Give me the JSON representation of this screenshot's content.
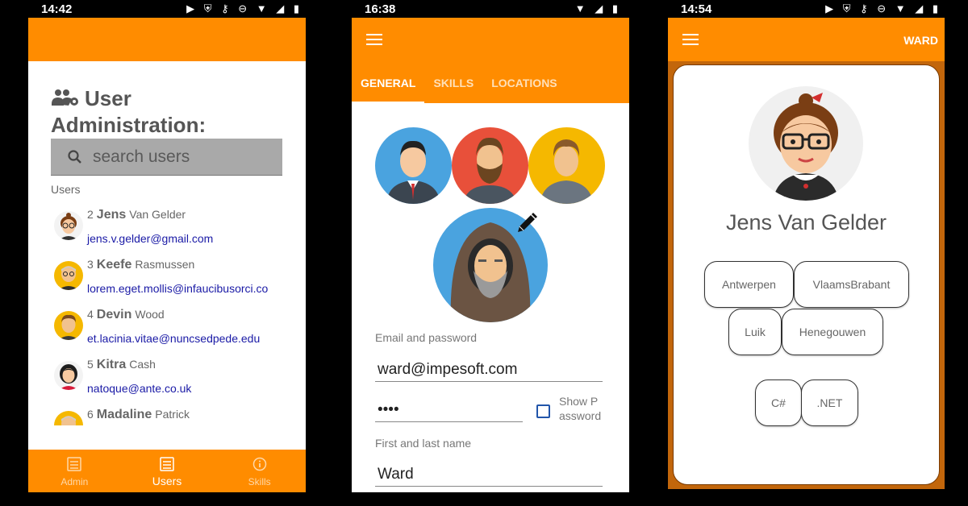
{
  "colors": {
    "accent": "#ff8c00",
    "email": "#1a1aa6",
    "frame": "#c2660b"
  },
  "phone1": {
    "status": {
      "time": "14:42",
      "icons": "▶ ⛨  ⚷ ⊖ ▼ ◢ ▮"
    },
    "title_line1": "User",
    "title_line2": "Administration:",
    "search": {
      "placeholder": "search users"
    },
    "users_label": "Users",
    "users": [
      {
        "id": "2",
        "first": "Jens",
        "last": "Van Gelder",
        "email": "jens.v.gelder@gmail.com",
        "avatar": "woman-glasses-avatar"
      },
      {
        "id": "3",
        "first": "Keefe",
        "last": "Rasmussen",
        "email": "lorem.eget.mollis@infaucibusorci.co",
        "avatar": "old-man-avatar"
      },
      {
        "id": "4",
        "first": "Devin",
        "last": "Wood",
        "email": "et.lacinia.vitae@nuncsedpede.edu",
        "avatar": "man-avatar"
      },
      {
        "id": "5",
        "first": "Kitra",
        "last": "Cash",
        "email": "natoque@ante.co.uk",
        "avatar": "woman-avatar"
      },
      {
        "id": "6",
        "first": "Madaline",
        "last": "Patrick",
        "email": "",
        "avatar": "old-man-avatar"
      }
    ],
    "nav": [
      {
        "label": "Admin",
        "icon": "admin-icon"
      },
      {
        "label": "Users",
        "icon": "users-list-icon"
      },
      {
        "label": "Skills",
        "icon": "info-icon"
      }
    ]
  },
  "phone2": {
    "status": {
      "time": "16:38",
      "icons": "▼ ◢ ▮"
    },
    "tabs": [
      "GENERAL",
      "SKILLS",
      "LOCATIONS"
    ],
    "email_label": "Email and password",
    "email_value": "ward@impesoft.com",
    "password_value": "••••",
    "show_password": "Show P assword",
    "name_label": "First and last name",
    "name_value": "Ward"
  },
  "phone3": {
    "status": {
      "time": "14:54",
      "icons": "▶ ⛨  ⚷ ⊖ ▼ ◢ ▮"
    },
    "user": "WARD",
    "name": "Jens Van Gelder",
    "locations": [
      "Antwerpen",
      "VlaamsBrabant",
      "Luik",
      "Henegouwen"
    ],
    "skills": [
      "C#",
      ".NET"
    ]
  }
}
